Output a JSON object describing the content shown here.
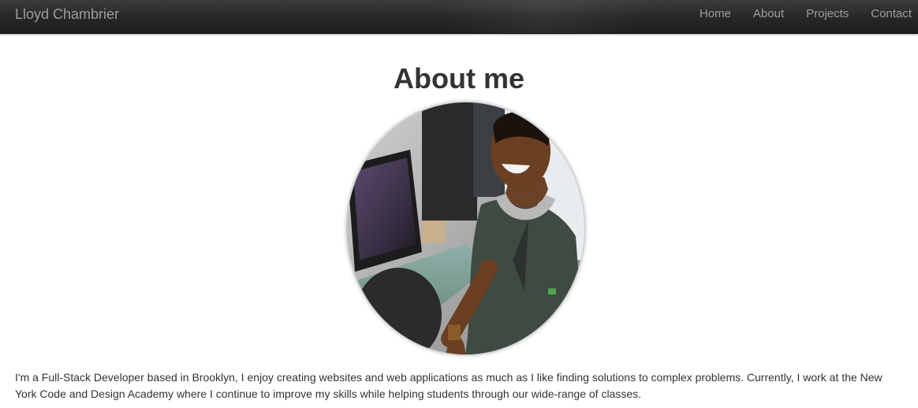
{
  "navbar": {
    "brand": "Lloyd Chambrier",
    "links": [
      {
        "label": "Home"
      },
      {
        "label": "About"
      },
      {
        "label": "Projects"
      },
      {
        "label": "Contact"
      }
    ]
  },
  "main": {
    "title": "About me",
    "bio": "I'm a Full-Stack Developer based in Brooklyn, I enjoy creating websites and web applications as much as I like finding solutions to complex problems. Currently, I work at the New York Code and Design Academy where I continue to improve my skills while helping students through our wide-range of classes."
  },
  "colors": {
    "navbar_bg": "#222222",
    "nav_text": "#9d9d9d",
    "body_text": "#333333"
  },
  "icons": {
    "profile_photo": "profile-photo"
  }
}
